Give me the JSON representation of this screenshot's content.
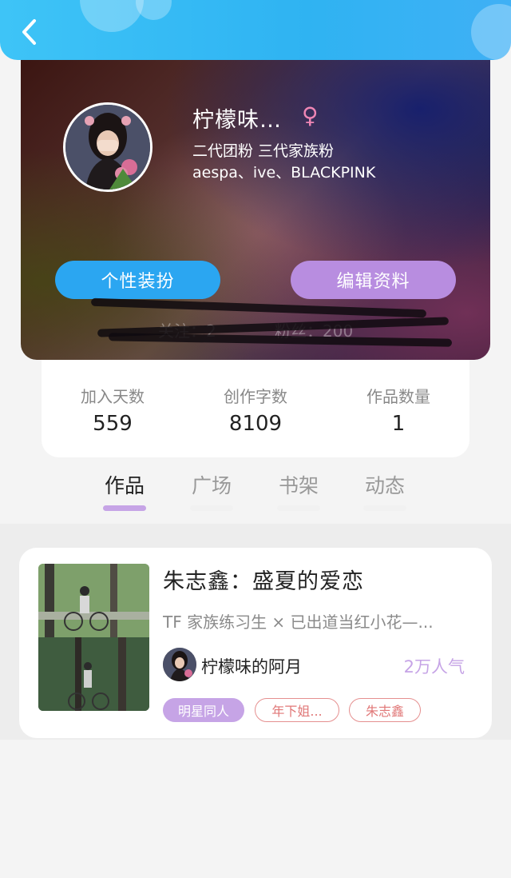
{
  "header": {
    "back_icon": "chevron-left-icon"
  },
  "profile": {
    "nickname": "柠檬味…",
    "gender_symbol": "♀",
    "bio_line1": "二代团粉 三代家族粉",
    "bio_line2": "aespa、ive、BLACKPINK",
    "dress_button": "个性装扮",
    "edit_button": "编辑资料",
    "following_text": "关注：2",
    "followers_text": "粉丝：200"
  },
  "stats": [
    {
      "label": "加入天数",
      "value": "559"
    },
    {
      "label": "创作字数",
      "value": "8109"
    },
    {
      "label": "作品数量",
      "value": "1"
    }
  ],
  "tabs": [
    {
      "label": "作品",
      "active": true
    },
    {
      "label": "广场",
      "active": false
    },
    {
      "label": "书架",
      "active": false
    },
    {
      "label": "动态",
      "active": false
    }
  ],
  "work": {
    "title": "朱志鑫：盛夏的爱恋",
    "description": "TF 家族练习生 × 已出道当红小花—...",
    "author": "柠檬味的阿月",
    "popularity": "2万人气",
    "tags": [
      "明星同人",
      "年下姐...",
      "朱志鑫"
    ]
  },
  "colors": {
    "header_blue": "#2fb3f2",
    "dress_button": "#2ba6f1",
    "edit_button": "#b88de0",
    "accent_purple": "#c6a4e6",
    "tag_outline_red": "#e58f8f"
  }
}
